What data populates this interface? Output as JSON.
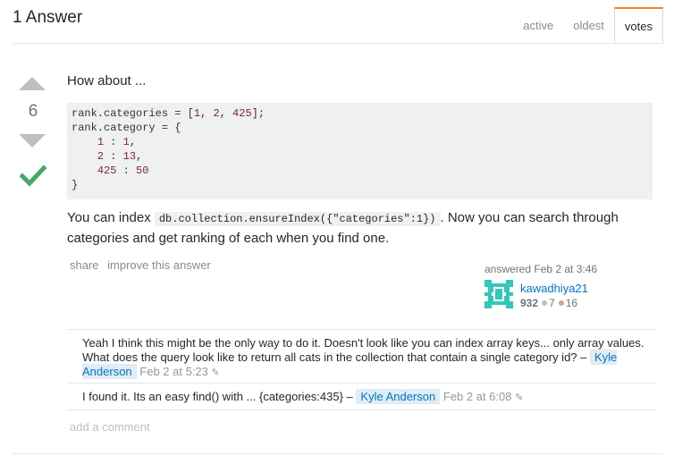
{
  "header": {
    "title": "1 Answer",
    "tabs": [
      {
        "label": "active"
      },
      {
        "label": "oldest"
      },
      {
        "label": "votes",
        "selected": true
      }
    ]
  },
  "vote": {
    "count": "6",
    "up_icon": "arrow-up-icon",
    "down_icon": "arrow-down-icon",
    "accepted_icon": "checkmark-icon",
    "accepted_color": "#48a868"
  },
  "post": {
    "intro": "How about ...",
    "code": {
      "line1_a": "rank.categories = [",
      "line1_n1": "1",
      "line1_s1": ", ",
      "line1_n2": "2",
      "line1_s2": ", ",
      "line1_n3": "425",
      "line1_end": "];",
      "line2": "rank.category = {",
      "line3_a": "    ",
      "line3_n1": "1",
      "line3_s": " : ",
      "line3_n2": "1",
      "line3_end": ",",
      "line4_a": "    ",
      "line4_n1": "2",
      "line4_s": " : ",
      "line4_n2": "13",
      "line4_end": ",",
      "line5_a": "    ",
      "line5_n1": "425",
      "line5_s": " : ",
      "line5_n2": "50",
      "line6": "}"
    },
    "desc_before": "You can index ",
    "desc_code": "db.collection.ensureIndex({\"categories\":1})",
    "desc_after": ". Now you can search through categories and get ranking of each when you find one."
  },
  "menu": {
    "share": "share",
    "improve": "improve this answer"
  },
  "signature": {
    "answered": "answered Feb 2 at 3:46",
    "username": "kawadhiya21",
    "reputation": "932",
    "silver": "7",
    "bronze": "16",
    "silver_color": "#bbc0c4",
    "bronze_color": "#d1a684",
    "avatar_icon": "identicon-icon",
    "avatar_color": "#32c8b8"
  },
  "comments": [
    {
      "text": "Yeah I think this might be the only way to do it. Doesn't look like you can index array keys... only array values. What does the query look like to return all cats in the collection that contain a single category id? – ",
      "user": "Kyle Anderson",
      "date": "Feb 2 at 5:23",
      "edit_icon": "pencil-icon"
    },
    {
      "text": "I found it. Its an easy find() with ... {categories:435} – ",
      "user": "Kyle Anderson",
      "date": "Feb 2 at 6:08",
      "edit_icon": "pencil-icon"
    }
  ],
  "add_comment": "add a comment"
}
